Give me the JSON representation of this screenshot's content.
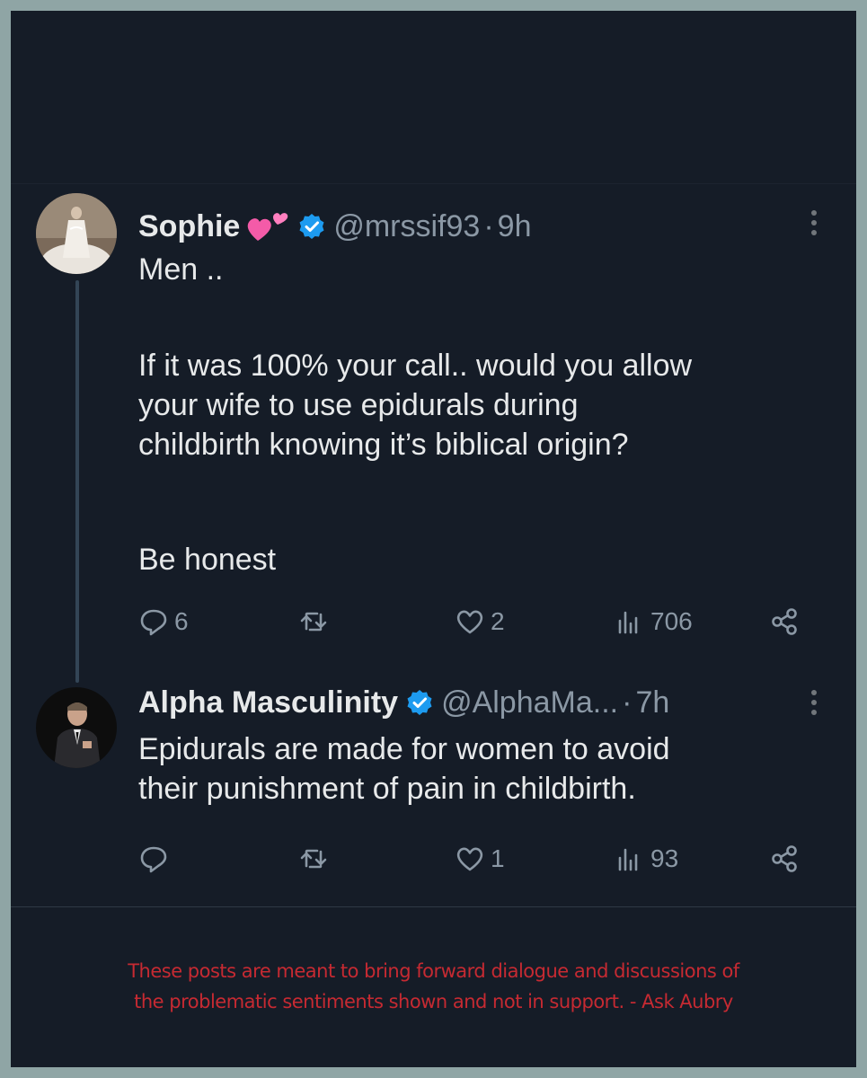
{
  "colors": {
    "background": "#151c27",
    "border": "#8fa5a5",
    "text_primary": "#e7e9ea",
    "text_secondary": "#8b98a5",
    "verified": "#1d9bf0",
    "disclaimer": "#c62a32"
  },
  "posts": [
    {
      "name": "Sophie",
      "emoji": "two-hearts-icon",
      "verified": true,
      "handle": "@mrssif93",
      "separator": "·",
      "time": "9h",
      "text": {
        "line1": "Men ..",
        "para2_line1": "If it was 100% your call.. would you allow",
        "para2_line2": "your wife to use epidurals during",
        "para2_line3": "childbirth knowing it’s biblical origin?",
        "line_last": "Be honest"
      },
      "actions": {
        "replies": "6",
        "retweets": "",
        "likes": "2",
        "views": "706"
      }
    },
    {
      "name": "Alpha Masculinity",
      "verified": true,
      "handle": "@AlphaMa...",
      "separator": "·",
      "time": "7h",
      "text": {
        "line1": "Epidurals are made for women to avoid",
        "line2": "their punishment of pain in childbirth."
      },
      "actions": {
        "replies": "",
        "retweets": "",
        "likes": "1",
        "views": "93"
      }
    }
  ],
  "disclaimer": {
    "line1": "These posts are meant to bring forward dialogue and discussions of",
    "line2": "the problematic sentiments shown and not in support. - Ask Aubry"
  }
}
